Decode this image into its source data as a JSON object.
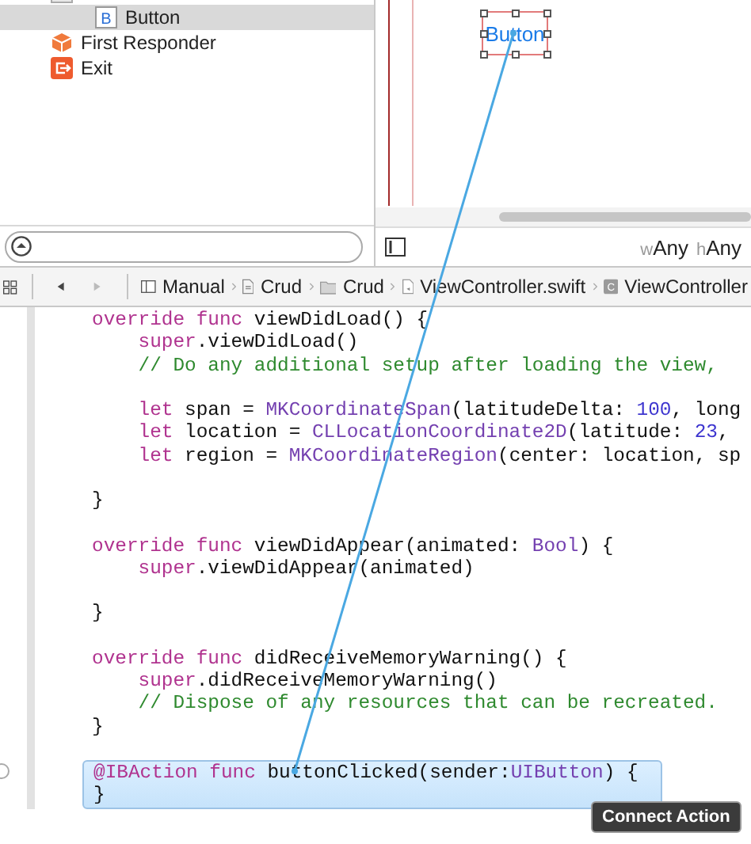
{
  "outline": {
    "items": [
      {
        "kind": "view",
        "children": [
          {
            "kind": "button",
            "icon_letter": "B",
            "label": "Button",
            "selected": true
          }
        ]
      },
      {
        "kind": "first_responder",
        "label": "First Responder",
        "selected": false
      },
      {
        "kind": "exit",
        "label": "Exit",
        "selected": false
      }
    ]
  },
  "canvas": {
    "button_label": "Button",
    "selected": true
  },
  "size_class": [
    {
      "prefix": "w",
      "value": "Any"
    },
    {
      "prefix": "h",
      "value": "Any"
    }
  ],
  "jump_bar": {
    "back_enabled": true,
    "forward_enabled": false,
    "crumbs": [
      {
        "kind": "layout",
        "label": "Manual"
      },
      {
        "kind": "project",
        "label": "Crud"
      },
      {
        "kind": "folder",
        "label": "Crud"
      },
      {
        "kind": "swift_file",
        "label": "ViewController.swift"
      },
      {
        "kind": "class",
        "icon_letter": "C",
        "label": "ViewController"
      }
    ]
  },
  "code": {
    "lines": [
      {
        "kind": "code",
        "tokens": [
          {
            "kind": "keyword",
            "text": "override func"
          },
          {
            "kind": "plain",
            "text": " viewDidLoad() {"
          }
        ]
      },
      {
        "kind": "indented",
        "tokens": [
          {
            "kind": "keyword",
            "text": "super"
          },
          {
            "kind": "plain",
            "text": ".viewDidLoad()"
          }
        ]
      },
      {
        "kind": "indented",
        "tokens": [
          {
            "kind": "comment",
            "text": "// Do any additional setup after loading the view,"
          }
        ]
      },
      {
        "kind": "blank"
      },
      {
        "kind": "indented",
        "tokens": [
          {
            "kind": "keyword",
            "text": "let"
          },
          {
            "kind": "plain",
            "text": " span = "
          },
          {
            "kind": "type",
            "text": "MKCoordinateSpan"
          },
          {
            "kind": "plain",
            "text": "(latitudeDelta: "
          },
          {
            "kind": "number",
            "text": "100"
          },
          {
            "kind": "plain",
            "text": ", long"
          }
        ]
      },
      {
        "kind": "indented",
        "tokens": [
          {
            "kind": "keyword",
            "text": "let"
          },
          {
            "kind": "plain",
            "text": " location = "
          },
          {
            "kind": "type",
            "text": "CLLocationCoordinate2D"
          },
          {
            "kind": "plain",
            "text": "(latitude: "
          },
          {
            "kind": "number",
            "text": "23"
          },
          {
            "kind": "plain",
            "text": ","
          }
        ]
      },
      {
        "kind": "indented",
        "tokens": [
          {
            "kind": "keyword",
            "text": "let"
          },
          {
            "kind": "plain",
            "text": " region = "
          },
          {
            "kind": "type",
            "text": "MKCoordinateRegion"
          },
          {
            "kind": "plain",
            "text": "(center: location, sp"
          }
        ]
      },
      {
        "kind": "blank"
      },
      {
        "kind": "code",
        "tokens": [
          {
            "kind": "plain",
            "text": "}"
          }
        ]
      },
      {
        "kind": "blank"
      },
      {
        "kind": "code",
        "tokens": [
          {
            "kind": "keyword",
            "text": "override func"
          },
          {
            "kind": "plain",
            "text": " viewDidAppear(animated: "
          },
          {
            "kind": "type",
            "text": "Bool"
          },
          {
            "kind": "plain",
            "text": ") {"
          }
        ]
      },
      {
        "kind": "indented",
        "tokens": [
          {
            "kind": "keyword",
            "text": "super"
          },
          {
            "kind": "plain",
            "text": ".viewDidAppear(animated)"
          }
        ]
      },
      {
        "kind": "blank"
      },
      {
        "kind": "code",
        "tokens": [
          {
            "kind": "plain",
            "text": "}"
          }
        ]
      },
      {
        "kind": "blank"
      },
      {
        "kind": "code",
        "tokens": [
          {
            "kind": "keyword",
            "text": "override func"
          },
          {
            "kind": "plain",
            "text": " didReceiveMemoryWarning() {"
          }
        ]
      },
      {
        "kind": "indented",
        "tokens": [
          {
            "kind": "keyword",
            "text": "super"
          },
          {
            "kind": "plain",
            "text": ".didReceiveMemoryWarning()"
          }
        ]
      },
      {
        "kind": "indented",
        "tokens": [
          {
            "kind": "comment",
            "text": "// Dispose of any resources that can be recreated."
          }
        ]
      },
      {
        "kind": "code",
        "tokens": [
          {
            "kind": "plain",
            "text": "}"
          }
        ]
      },
      {
        "kind": "blank"
      }
    ],
    "insertion": {
      "lines": [
        {
          "kind": "code",
          "tokens": [
            {
              "kind": "keyword",
              "text": "@IBAction func"
            },
            {
              "kind": "plain",
              "text": " buttonClicked(sender:"
            },
            {
              "kind": "type",
              "text": "UIButton"
            },
            {
              "kind": "plain",
              "text": ") {"
            }
          ]
        },
        {
          "kind": "code",
          "tokens": [
            {
              "kind": "plain",
              "text": "}"
            }
          ]
        }
      ]
    }
  },
  "tooltip": "Connect Action"
}
